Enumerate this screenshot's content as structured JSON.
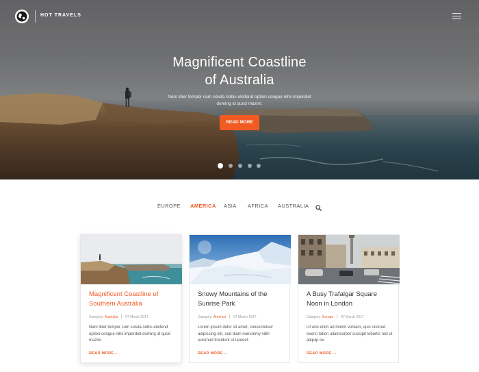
{
  "header": {
    "brand": "HOT TRAVELS",
    "logo_icon": "globe-icon",
    "menu_icon": "hamburger-menu-icon"
  },
  "hero": {
    "title_line1": "Magnificent Coastline",
    "title_line2": "of Australia",
    "subtitle": "Nam liber tempor cum soluta nobis eleifend option congue nihil imperdiet doming id quod mazim.",
    "button": "READ MORE",
    "slides": 5,
    "active_slide": 1
  },
  "nav": {
    "items": [
      "EUROPE",
      "AMERICA",
      "ASIA",
      "AFRICA",
      "AUSTRALIA"
    ],
    "active": "AMERICA",
    "search_icon": "search-icon"
  },
  "cards": [
    {
      "title": "Magnificent Coastline of Southern Australia",
      "category_label": "Category:",
      "category": "Australia",
      "date": "07 March 2017",
      "text": "Nam liber tempor cum soluta nobis eleifend option congue nihil imperdiet doming id quod mazim.",
      "more": "READ MORE ..."
    },
    {
      "title": "Snowy Mountains of the Sunrise Park",
      "category_label": "Category:",
      "category": "America",
      "date": "07 March 2017",
      "text": "Lorem ipsum dolor sit amet, consectetuer adipiscing elit, sed diam nonummy nibh euismod tincidunt ut laoreet.",
      "more": "READ MORE ..."
    },
    {
      "title": "A Busy Trafalgar Square Noon in London",
      "category_label": "Category:",
      "category": "Europe",
      "date": "07 March 2017",
      "text": "Ut wisi enim ad minim veniam, quis nostrud exerci tation ullamcorper suscipit lobortis nisl ut aliquip ex.",
      "more": "READ MORE ..."
    }
  ],
  "colors": {
    "accent": "#f15a22",
    "text": "#333333",
    "muted": "#999999"
  }
}
